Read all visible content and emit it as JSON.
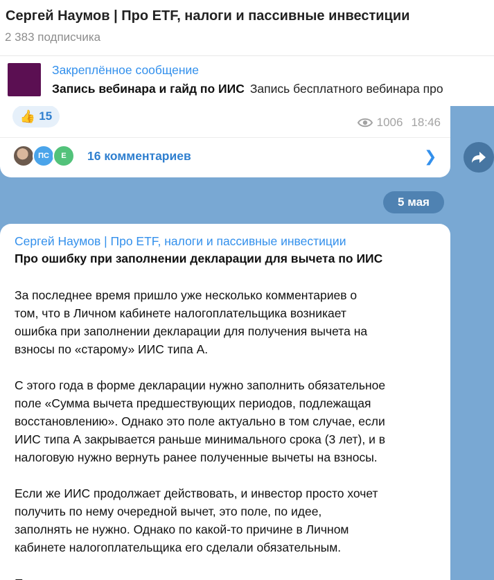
{
  "header": {
    "title": "Сергей Наумов | Про ETF, налоги и пассивные инвестиции",
    "subscribers": "2 383 подписчика"
  },
  "pinned": {
    "label": "Закреплённое сообщение",
    "title": "Запись вебинара и гайд по ИИС",
    "preview": "Запись бесплатного вебинара про"
  },
  "previous_message": {
    "reaction_emoji": "👍",
    "reaction_count": "15",
    "views": "1006",
    "time": "18:46",
    "comment_avatars": [
      "",
      "ПС",
      "Е"
    ],
    "comments_label": "16 комментариев"
  },
  "date_separator": "5 мая",
  "post": {
    "author": "Сергей Наумов | Про ETF, налоги и пассивные инвестиции",
    "title": "Про ошибку при заполнении декларации для вычета по ИИС",
    "paragraphs": [
      [
        "За последнее время пришло уже несколько комментариев о",
        "том, что в Личном кабинете налогоплательщика возникает",
        "ошибка при заполнении декларации для получения вычета на",
        "взносы по «старому» ИИС типа А."
      ],
      [
        "С этого года в форме декларации нужно заполнить обязательное",
        "поле «Сумма вычета предшествующих периодов, подлежащая",
        "восстановлению». Однако это поле актуально в том случае, если",
        "ИИС типа А закрывается раньше минимального срока (3 лет), и в",
        "налоговую нужно вернуть ранее полученные вычеты на взносы."
      ],
      [
        "Если же ИИС продолжает действовать, и инвестор просто хочет",
        "получить по нему очередной вычет, это поле, по идее,",
        "заполнять не нужно. Однако по какой-то причине в Личном",
        "кабинете налогоплательщика его сделали обязательным."
      ],
      [
        "По"
      ]
    ]
  },
  "colors": {
    "accent": "#3390ec",
    "chat_background": "#79a8d3",
    "pinned_thumbnail": "#5b0f52"
  }
}
